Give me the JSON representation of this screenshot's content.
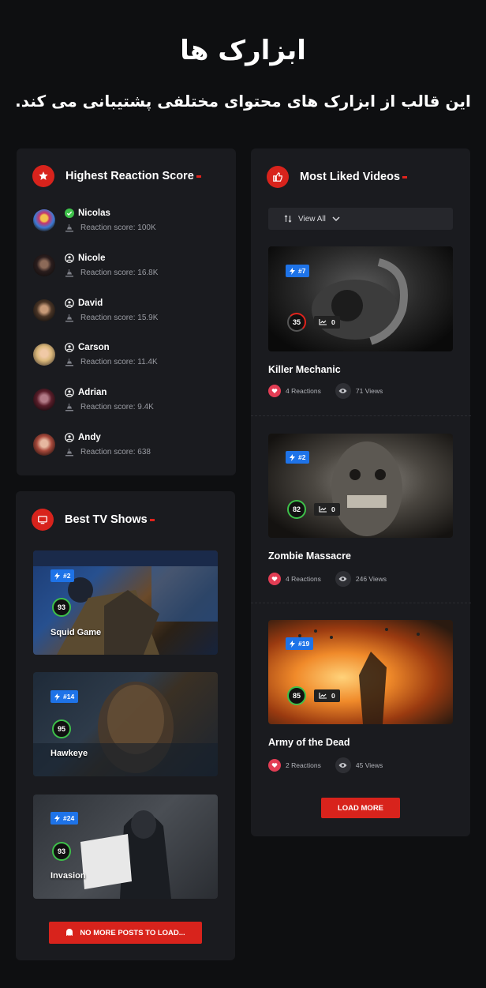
{
  "hero": {
    "title": "ابزارک ها",
    "subtitle": "این قالب از ابزارک های محتوای مختلفی پشتیبانی می کند."
  },
  "reaction_panel": {
    "title": "Highest Reaction Score",
    "icon": "star-badge-icon",
    "users": [
      {
        "name": "Nicolas",
        "score_label": "Reaction score: 100K",
        "badge": "verified-check-icon",
        "avatar_color": "#8a4fb3"
      },
      {
        "name": "Nicole",
        "score_label": "Reaction score: 16.8K",
        "badge": "user-circle-icon",
        "avatar_color": "#3a2a2a"
      },
      {
        "name": "David",
        "score_label": "Reaction score: 15.9K",
        "badge": "user-circle-icon",
        "avatar_color": "#5a4030"
      },
      {
        "name": "Carson",
        "score_label": "Reaction score: 11.4K",
        "badge": "user-circle-icon",
        "avatar_color": "#d9b77a"
      },
      {
        "name": "Adrian",
        "score_label": "Reaction score: 9.4K",
        "badge": "user-circle-icon",
        "avatar_color": "#6b2330"
      },
      {
        "name": "Andy",
        "score_label": "Reaction score: 638",
        "badge": "user-circle-icon",
        "avatar_color": "#a84a3c"
      }
    ]
  },
  "tv_panel": {
    "title": "Best TV Shows",
    "icon": "tv-icon",
    "shows": [
      {
        "title": "Squid Game",
        "rank": "#2",
        "score": "93"
      },
      {
        "title": "Hawkeye",
        "rank": "#14",
        "score": "95"
      },
      {
        "title": "Invasion",
        "rank": "#24",
        "score": "93"
      }
    ],
    "button_label": "NO MORE POSTS TO LOAD..."
  },
  "videos_panel": {
    "title": "Most Liked Videos",
    "icon": "thumbs-up-icon",
    "filter_label": "View All",
    "videos": [
      {
        "title": "Killer Mechanic",
        "rank": "#7",
        "score": "35",
        "trend": "0",
        "reactions": "4 Reactions",
        "views": "71 Views"
      },
      {
        "title": "Zombie Massacre",
        "rank": "#2",
        "score": "82",
        "trend": "0",
        "reactions": "4 Reactions",
        "views": "246 Views"
      },
      {
        "title": "Army of the Dead",
        "rank": "#19",
        "score": "85",
        "trend": "0",
        "reactions": "2 Reactions",
        "views": "45 Views"
      }
    ],
    "button_label": "LOAD MORE"
  },
  "colors": {
    "accent": "#d8231c",
    "rank_badge": "#1e73e8",
    "score_ring": "#3ec14a",
    "panel": "#1a1b1f",
    "background": "#0e0f11"
  }
}
